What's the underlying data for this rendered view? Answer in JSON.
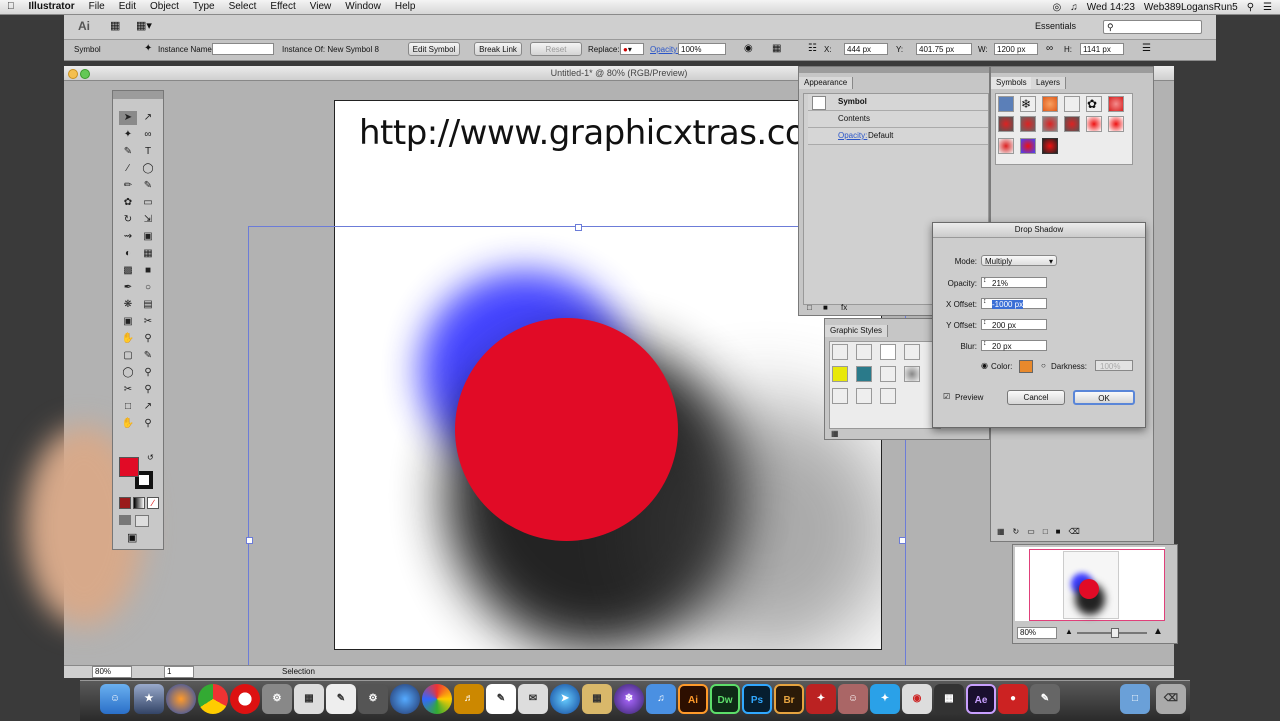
{
  "menubar": {
    "app_name": "Illustrator",
    "items": [
      "File",
      "Edit",
      "Object",
      "Type",
      "Select",
      "Effect",
      "View",
      "Window",
      "Help"
    ],
    "clock": "Wed 14:23",
    "user": "Web389LogansRun5"
  },
  "appbar": {
    "logo": "Ai",
    "workspace": "Essentials",
    "search_placeholder": ""
  },
  "control": {
    "selection_type": "Symbol",
    "instance_name_label": "Instance Name:",
    "instance_name_value": "",
    "instance_of_label": "Instance Of: New Symbol 8",
    "edit_symbol": "Edit Symbol",
    "break_link": "Break Link",
    "reset": "Reset",
    "replace_label": "Replace:",
    "opacity_label": "Opacity:",
    "opacity_value": "100%",
    "x_label": "X:",
    "x_value": "444 px",
    "y_label": "Y:",
    "y_value": "401.75 px",
    "w_label": "W:",
    "w_value": "1200 px",
    "h_label": "H:",
    "h_value": "1141 px"
  },
  "document": {
    "title": "Untitled-1* @ 80% (RGB/Preview)",
    "artboard_text": "http://www.graphicxtras.com",
    "zoom": "80%",
    "page": "1",
    "status": "Selection",
    "circle_color": "#e10b26",
    "shadow_blue": "#3b3bff"
  },
  "appearance_panel": {
    "tab": "Appearance",
    "rows": [
      "Symbol",
      "Contents",
      "Opacity:",
      "Default"
    ]
  },
  "symbols_panel": {
    "tabs": [
      "Symbols",
      "Layers"
    ]
  },
  "graphic_styles_panel": {
    "tab": "Graphic Styles"
  },
  "drop_shadow": {
    "title": "Drop Shadow",
    "mode_label": "Mode:",
    "mode_value": "Multiply",
    "opacity_label": "Opacity:",
    "opacity_value": "21%",
    "x_offset_label": "X Offset:",
    "x_offset_value": "-1000 px",
    "y_offset_label": "Y Offset:",
    "y_offset_value": "200 px",
    "blur_label": "Blur:",
    "blur_value": "20 px",
    "color_label": "Color:",
    "darkness_label": "Darkness:",
    "darkness_value": "100%",
    "shadow_color": "#e8892c",
    "preview_label": "Preview",
    "cancel": "Cancel",
    "ok": "OK"
  },
  "navigator": {
    "zoom_value": "80%"
  },
  "dock": {
    "apps": [
      "Ai",
      "Dw",
      "Ps",
      "Br",
      "Ae"
    ]
  }
}
